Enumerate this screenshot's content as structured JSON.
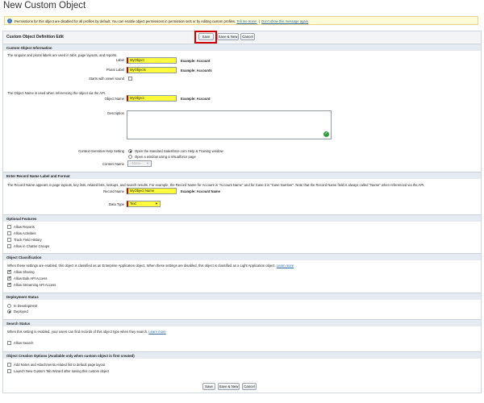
{
  "page": {
    "title": "New Custom Object"
  },
  "info_bar": {
    "text": "Permissions for this object are disabled for all profiles by default. You can enable object permissions in permission sets or by editing custom profiles.",
    "tell_me_more": "Tell me more!",
    "dont_show": "Don't show this message again"
  },
  "buttons": {
    "save": "Save",
    "save_new": "Save & New",
    "cancel": "Cancel"
  },
  "header": {
    "title": "Custom Object Definition Edit"
  },
  "custom_object_info": {
    "heading": "Custom Object Information",
    "intro": "The singular and plural labels are used in tabs, page layouts, and reports.",
    "label_label": "Label",
    "label_value": "MyObject",
    "label_example": "Example:  Account",
    "plural_label_label": "Plural Label",
    "plural_label_value": "MyObjects",
    "plural_example": "Example:  Accounts",
    "vowel_label": "Starts with vowel sound",
    "api_intro": "The Object Name is used when referencing the object via the API.",
    "object_name_label": "Object Name",
    "object_name_value": "MyObject",
    "object_name_example": "Example:  Account",
    "description_label": "Description",
    "help_setting_label": "Context-Sensitive Help Setting",
    "help_option_1": "Open the standard Salesforce.com Help & Training window",
    "help_option_2": "Open a window using a Visualforce page",
    "content_name_label": "Content Name",
    "content_name_value": "--None--"
  },
  "record_name": {
    "heading": "Enter Record Name Label and Format",
    "intro": "The Record Name appears in page layouts, key lists, related lists, lookups, and search results. For example, the Record Name for Account is \"Account Name\" and for Case it is \"Case Number\". Note that the Record Name field is always called \"Name\" when referenced via the API.",
    "record_name_label": "Record Name",
    "record_name_value": "MyObject Name",
    "record_name_example": "Example:  Account Name",
    "data_type_label": "Data Type",
    "data_type_value": "Text"
  },
  "optional_features": {
    "heading": "Optional Features",
    "items": [
      {
        "label": "Allow Reports",
        "checked": false
      },
      {
        "label": "Allow Activities",
        "checked": false
      },
      {
        "label": "Track Field History",
        "checked": false
      },
      {
        "label": "Allow in Chatter Groups",
        "checked": false
      }
    ]
  },
  "object_classification": {
    "heading": "Object Classification",
    "intro": "When these settings are enabled, this object is classified as an Enterprise Application object. When these settings are disabled, this object is classified as a Light Application object.",
    "learn_more": "Learn more",
    "items": [
      {
        "label": "Allow Sharing",
        "checked": true
      },
      {
        "label": "Allow Bulk API Access",
        "checked": true
      },
      {
        "label": "Allow Streaming API Access",
        "checked": true
      }
    ]
  },
  "deployment_status": {
    "heading": "Deployment Status",
    "items": [
      {
        "label": "In Development",
        "selected": false
      },
      {
        "label": "Deployed",
        "selected": true
      }
    ]
  },
  "search_status": {
    "heading": "Search Status",
    "intro": "When this setting is enabled, your users can find records of this object type when they search.",
    "learn_more": "Learn more",
    "allow_search": "Allow Search"
  },
  "creation_options": {
    "heading": "Object Creation Options (Available only when custom object is first created)",
    "items": [
      {
        "label": "Add Notes and Attachments related list to default page layout",
        "checked": false
      },
      {
        "label": "Launch New Custom Tab Wizard after saving this custom object",
        "checked": false
      }
    ]
  },
  "colors": {
    "highlight": "#fffb3c",
    "required": "#c20000",
    "section_bg": "#e6ebf1",
    "red_box": "#d10000"
  }
}
